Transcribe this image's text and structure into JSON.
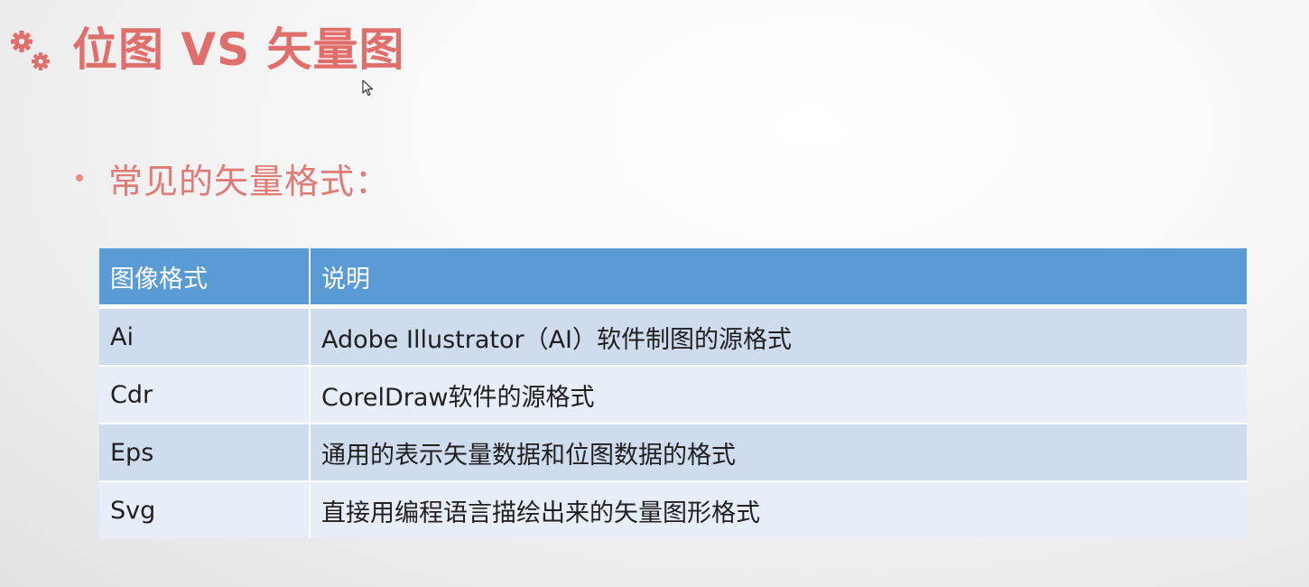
{
  "slide": {
    "title": "位图 VS 矢量图",
    "bullet": "常见的矢量格式：",
    "accent_color": "#e06f6c",
    "header_color": "#5b9bd5",
    "icons": [
      "gears-icon",
      "mouse-cursor-icon"
    ]
  },
  "table": {
    "headers": [
      "图像格式",
      "说明"
    ],
    "rows": [
      {
        "format": "Ai",
        "desc": "Adobe Illustrator（AI）软件制图的源格式"
      },
      {
        "format": "Cdr",
        "desc": "CorelDraw软件的源格式"
      },
      {
        "format": "Eps",
        "desc": "通用的表示矢量数据和位图数据的格式"
      },
      {
        "format": "Svg",
        "desc": "直接用编程语言描绘出来的矢量图形格式"
      }
    ]
  }
}
